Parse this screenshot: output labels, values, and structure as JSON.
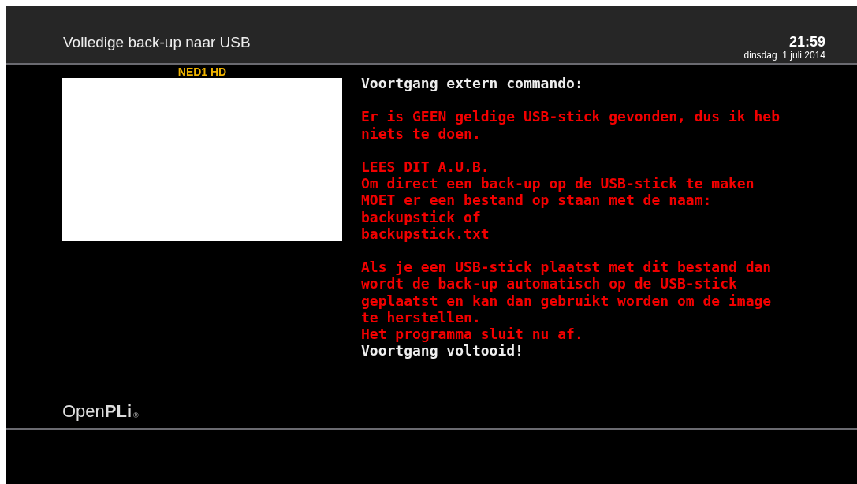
{
  "header": {
    "title": "Volledige back-up naar USB",
    "time": "21:59",
    "date": "dinsdag  1 juli 2014"
  },
  "preview": {
    "channel": "NED1 HD"
  },
  "output": [
    {
      "lines": [
        {
          "kind": "info",
          "text": "Voortgang extern commando:"
        }
      ]
    },
    {
      "lines": [
        {
          "kind": "error",
          "text": "Er is GEEN geldige USB-stick gevonden, dus ik heb niets te doen."
        }
      ]
    },
    {
      "lines": [
        {
          "kind": "error",
          "text": "LEES DIT A.U.B."
        },
        {
          "kind": "error",
          "text": "Om direct een back-up op de USB-stick te maken"
        },
        {
          "kind": "error",
          "text": "MOET er een bestand op staan met de naam:"
        },
        {
          "kind": "error",
          "text": "backupstick of"
        },
        {
          "kind": "error",
          "text": "backupstick.txt"
        }
      ]
    },
    {
      "lines": [
        {
          "kind": "error",
          "text": "Als je een USB-stick plaatst met dit bestand dan wordt de back-up automatisch op de USB-stick geplaatst en kan dan gebruikt worden om de image te herstellen."
        },
        {
          "kind": "error",
          "text": "Het programma sluit nu af."
        },
        {
          "kind": "info",
          "text": "Voortgang voltooid!"
        }
      ]
    }
  ],
  "logo": {
    "text": "Open**PLi**",
    "mark": "®"
  }
}
